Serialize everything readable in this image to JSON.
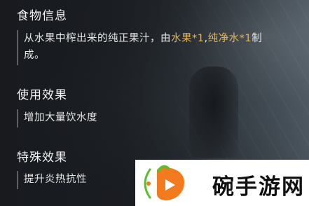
{
  "food_info": {
    "title": "食物信息",
    "desc_line1_a": "从水果中榨出来的纯正果汁，由",
    "desc_line1_b": "水果*1",
    "desc_line1_c": ",",
    "desc_line1_d": "纯净水*1",
    "desc_line1_e": "制",
    "desc_line2": "成。"
  },
  "use_effect": {
    "title": "使用效果",
    "desc": "增加大量饮水度"
  },
  "special_effect": {
    "title": "特殊效果",
    "desc": "提升炎热抗性"
  },
  "watermark": {
    "text": "碗手游网"
  },
  "colors": {
    "highlight": "#e0b45a",
    "text": "#e6e6e6",
    "logo_green": "#5bbf2a",
    "logo_orange": "#f47a1f"
  }
}
